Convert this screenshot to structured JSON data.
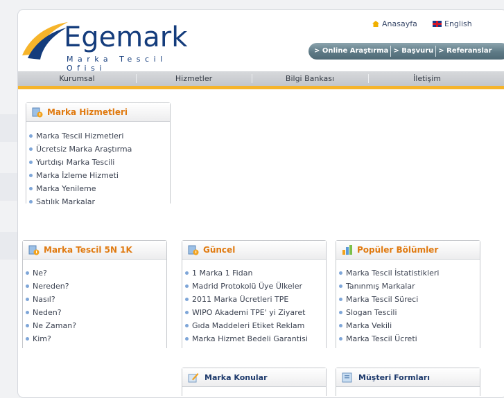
{
  "brand": {
    "name": "Egemark",
    "tagline": "Marka Tescil Ofisi",
    "colors": {
      "primary": "#143c7c",
      "accent": "#f6b42a",
      "heading": "#e07a10"
    }
  },
  "toplinks": {
    "home": "Anasayfa",
    "english": "English"
  },
  "quicklinks": [
    "> Online Araştırma",
    "> Başvuru",
    "> Referanslar"
  ],
  "nav": [
    "Kurumsal",
    "Hizmetler",
    "Bilgi Bankası",
    "İletişim"
  ],
  "boxes": {
    "marka_hizmetleri": {
      "title": "Marka Hizmetleri",
      "items": [
        "Marka Tescil Hizmetleri",
        "Ücretsiz Marka Araştırma",
        "Yurtdışı Marka Tescili",
        "Marka İzleme Hizmeti",
        "Marka Yenileme",
        "Satılık Markalar"
      ]
    },
    "tescil_5n1k": {
      "title": "Marka Tescil 5N 1K",
      "items": [
        "Ne?",
        "Nereden?",
        "Nasıl?",
        "Neden?",
        "Ne Zaman?",
        "Kim?"
      ]
    },
    "guncel": {
      "title": "Güncel",
      "items": [
        "1 Marka 1 Fidan",
        "Madrid Protokolü Üye Ülkeler",
        "2011 Marka Ücretleri TPE",
        "WIPO Akademi TPE' yi Ziyaret",
        "Gıda Maddeleri Etiket Reklam",
        "Marka Hizmet Bedeli Garantisi"
      ]
    },
    "populer": {
      "title": "Popüler Bölümler",
      "items": [
        "Marka Tescil İstatistikleri",
        "Tanınmış Markalar",
        "Marka Tescil Süreci",
        "Slogan Tescili",
        "Marka Vekili",
        "Marka Tescil Ücreti"
      ]
    },
    "konular": {
      "title": "Marka Konular"
    },
    "formlar": {
      "title": "Müşteri Formları"
    }
  }
}
